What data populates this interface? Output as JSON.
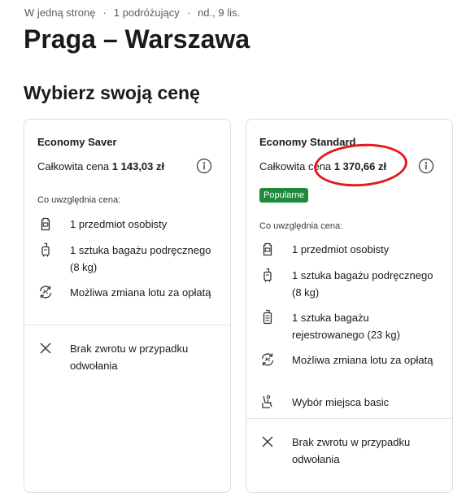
{
  "trip": {
    "type": "W jedną stronę",
    "travelers": "1 podróżujący",
    "date": "nd., 9 lis."
  },
  "route_title": "Praga – Warszawa",
  "section_title": "Wybierz swoją cenę",
  "fares": [
    {
      "name": "Economy Saver",
      "price_label": "Całkowita cena",
      "price": "1 143,03 zł",
      "includes_label": "Co uwzględnia cena:",
      "features": [
        {
          "icon": "personal-item-icon",
          "text": "1 przedmiot osobisty"
        },
        {
          "icon": "carry-on-bag-icon",
          "text": "1 sztuka bagażu podręcznego (8  kg)"
        },
        {
          "icon": "flight-change-icon",
          "text": "Możliwa zmiana lotu za opłatą"
        }
      ],
      "exclusions": [
        {
          "icon": "close-icon",
          "text": "Brak zwrotu w przypadku odwołania"
        }
      ]
    },
    {
      "name": "Economy Standard",
      "price_label": "Całkowita cena",
      "price": "1 370,66 zł",
      "badge": "Popularne",
      "includes_label": "Co uwzględnia cena:",
      "features": [
        {
          "icon": "personal-item-icon",
          "text": "1 przedmiot osobisty"
        },
        {
          "icon": "carry-on-bag-icon",
          "text": "1 sztuka bagażu podręcznego (8  kg)"
        },
        {
          "icon": "checked-bag-icon",
          "text": "1 sztuka bagażu rejestrowanego (23  kg)"
        },
        {
          "icon": "flight-change-icon",
          "text": "Możliwa zmiana lotu za opłatą"
        },
        {
          "icon": "seat-icon",
          "text": "Wybór miejsca basic"
        }
      ],
      "exclusions": [
        {
          "icon": "close-icon",
          "text": "Brak zwrotu w przypadku odwołania"
        }
      ]
    }
  ],
  "colors": {
    "popular_badge": "#1f8a3b",
    "annotation": "#e4181b",
    "text": "#1a1a1a"
  }
}
